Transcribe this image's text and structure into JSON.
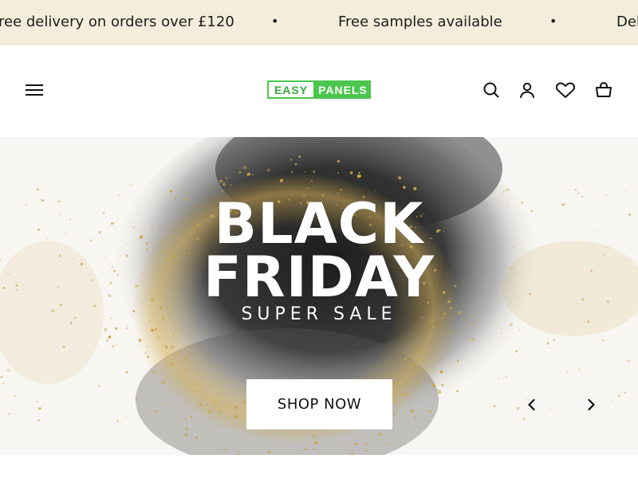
{
  "announcement": {
    "items": [
      "ree delivery on orders over £120",
      "Free samples available",
      "Del"
    ],
    "separator": "•"
  },
  "header": {
    "logo": {
      "part1": "EASY",
      "part2": "PANELS"
    },
    "icons": [
      "menu-icon",
      "search-icon",
      "account-icon",
      "wishlist-icon",
      "cart-icon"
    ]
  },
  "hero": {
    "line1": "BLACK",
    "line2": "FRIDAY",
    "line3": "SUPER SALE",
    "cta": "SHOP NOW"
  },
  "colors": {
    "announcement_bg": "#f4eddb",
    "brand_green": "#4cc64e",
    "gold": "#c9a64a"
  }
}
